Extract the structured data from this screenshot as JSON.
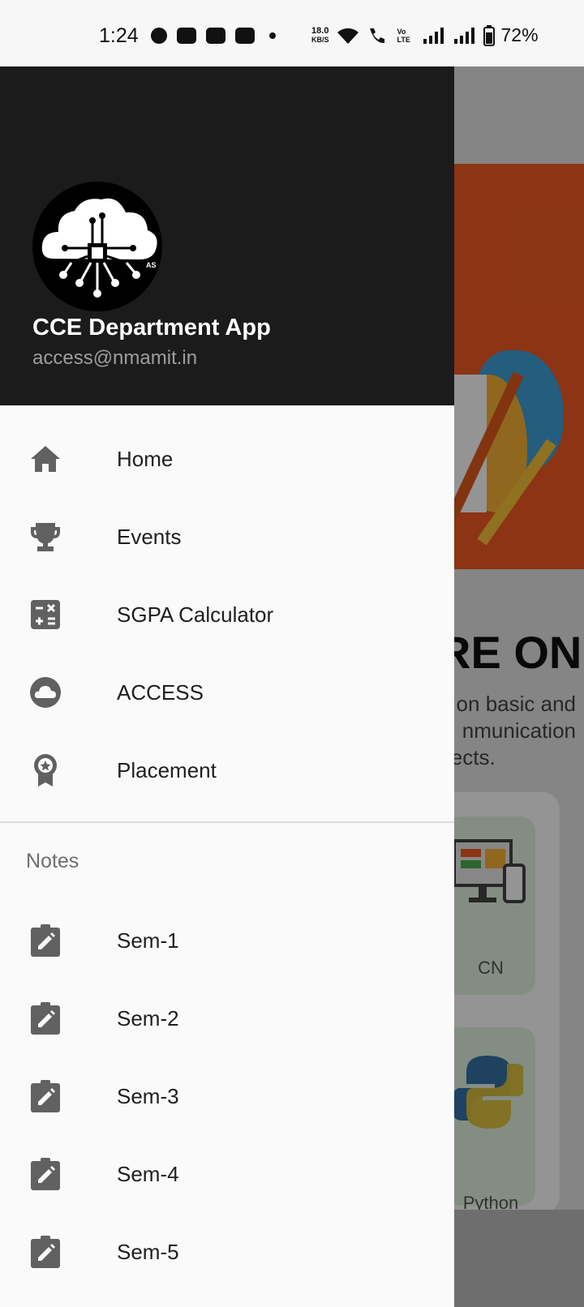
{
  "status_bar": {
    "time": "1:24",
    "net_speed_value": "18.0",
    "net_speed_unit": "KB/S",
    "volte": "Vo LTE",
    "battery": "72%",
    "notification_icons": [
      "chat-icon",
      "discord-icon",
      "game-icon",
      "youtube-icon"
    ]
  },
  "drawer": {
    "app_name": "CCE Department App",
    "email": "access@nmamit.in",
    "logo_text": "AS",
    "main_items": [
      {
        "label": "Home",
        "icon": "home-icon"
      },
      {
        "label": "Events",
        "icon": "trophy-icon"
      },
      {
        "label": "SGPA Calculator",
        "icon": "calculator-icon"
      },
      {
        "label": "ACCESS",
        "icon": "cloud-icon"
      },
      {
        "label": "Placement",
        "icon": "award-icon"
      }
    ],
    "notes_section_title": "Notes",
    "notes_items": [
      {
        "label": "Sem-1",
        "icon": "clipboard-edit-icon"
      },
      {
        "label": "Sem-2",
        "icon": "clipboard-edit-icon"
      },
      {
        "label": "Sem-3",
        "icon": "clipboard-edit-icon"
      },
      {
        "label": "Sem-4",
        "icon": "clipboard-edit-icon"
      },
      {
        "label": "Sem-5",
        "icon": "clipboard-edit-icon"
      }
    ]
  },
  "background_page": {
    "heading_fragment": "RE ON",
    "description_lines": [
      "on basic and",
      "nmunication",
      "jects."
    ],
    "cards": [
      {
        "label": "CN"
      },
      {
        "label": "Python"
      }
    ]
  },
  "colors": {
    "drawer_header": "#1b1b1b",
    "banner": "#f15b24",
    "icon_gray": "#616161"
  }
}
